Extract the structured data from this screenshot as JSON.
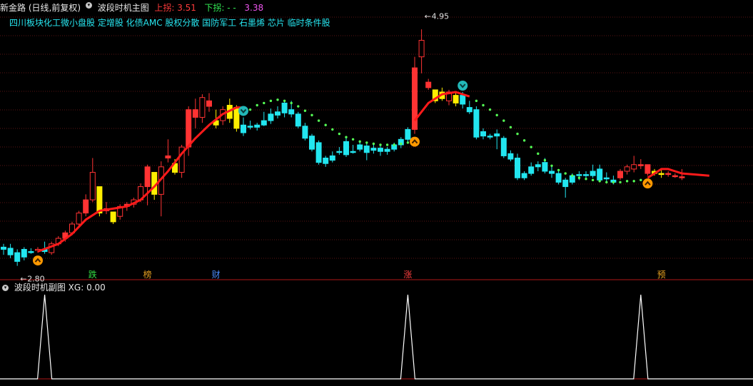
{
  "header": {
    "stock_name": "新金路",
    "period": "(日线,前复权)",
    "main_indicator": "波段时机主图",
    "upper_label": "上拐:",
    "upper_value": "3.51",
    "lower_label": "下拐:",
    "lower_value": "- -",
    "third_value": "3.38"
  },
  "concept_tags": "四川板块化工微小盘股 定增股 化债AMC 股权分散 国防军工 石墨烯 芯片 临时条件股",
  "price_labels": {
    "high": "4.95",
    "low": "2.80"
  },
  "event_markers": [
    {
      "label": "跌",
      "color": "#33dd44"
    },
    {
      "label": "榜",
      "color": "#e6a020"
    },
    {
      "label": "财",
      "color": "#4a8cff"
    },
    {
      "label": "涨",
      "color": "#ff4040"
    },
    {
      "label": "预",
      "color": "#e6a020"
    }
  ],
  "sub_panel": {
    "title": "波段时机副图",
    "xg_label": "XG:",
    "xg_value": "0.00"
  },
  "colors": {
    "up_candle": "#ff3333",
    "down_candle": "#22e6f0",
    "yellow_candle": "#ffee00",
    "trend_line": "#ff1a1a",
    "dots": "#55ff55",
    "grid": "#5a1414",
    "signal_line": "#ffffff",
    "buy_signal": "#ff9900",
    "sell_signal": "#22b8b8"
  },
  "chart_data": {
    "type": "candlestick",
    "candles": [
      {
        "o": 2.95,
        "h": 3.0,
        "l": 2.9,
        "c": 2.97,
        "k": "c"
      },
      {
        "o": 2.96,
        "h": 3.0,
        "l": 2.87,
        "c": 2.9,
        "k": "c"
      },
      {
        "o": 2.92,
        "h": 2.95,
        "l": 2.8,
        "c": 2.84,
        "k": "c"
      },
      {
        "o": 2.88,
        "h": 2.97,
        "l": 2.85,
        "c": 2.95,
        "k": "c"
      },
      {
        "o": 2.93,
        "h": 2.96,
        "l": 2.91,
        "c": 2.93,
        "k": "c"
      },
      {
        "o": 2.94,
        "h": 2.97,
        "l": 2.92,
        "c": 2.95,
        "k": "r"
      },
      {
        "o": 2.95,
        "h": 3.02,
        "l": 2.91,
        "c": 2.93,
        "k": "c"
      },
      {
        "o": 2.92,
        "h": 3.02,
        "l": 2.9,
        "c": 3.0,
        "k": "r"
      },
      {
        "o": 3.0,
        "h": 3.07,
        "l": 2.98,
        "c": 3.05,
        "k": "r"
      },
      {
        "o": 3.05,
        "h": 3.12,
        "l": 3.02,
        "c": 3.1,
        "k": "r"
      },
      {
        "o": 3.1,
        "h": 3.2,
        "l": 3.08,
        "c": 3.18,
        "k": "r"
      },
      {
        "o": 3.18,
        "h": 3.3,
        "l": 3.15,
        "c": 3.28,
        "k": "r"
      },
      {
        "o": 3.28,
        "h": 3.45,
        "l": 3.25,
        "c": 3.4,
        "k": "r"
      },
      {
        "o": 3.4,
        "h": 3.78,
        "l": 3.38,
        "c": 3.65,
        "k": "r"
      },
      {
        "o": 3.52,
        "h": 3.52,
        "l": 3.25,
        "c": 3.28,
        "k": "y"
      },
      {
        "o": 3.3,
        "h": 3.38,
        "l": 3.27,
        "c": 3.32,
        "k": "r"
      },
      {
        "o": 3.29,
        "h": 3.29,
        "l": 3.18,
        "c": 3.2,
        "k": "y"
      },
      {
        "o": 3.25,
        "h": 3.36,
        "l": 3.22,
        "c": 3.34,
        "k": "r"
      },
      {
        "o": 3.34,
        "h": 3.38,
        "l": 3.3,
        "c": 3.36,
        "k": "r"
      },
      {
        "o": 3.36,
        "h": 3.42,
        "l": 3.33,
        "c": 3.4,
        "k": "r"
      },
      {
        "o": 3.4,
        "h": 3.55,
        "l": 3.38,
        "c": 3.52,
        "k": "r"
      },
      {
        "o": 3.52,
        "h": 3.72,
        "l": 3.35,
        "c": 3.7,
        "k": "r"
      },
      {
        "o": 3.65,
        "h": 3.65,
        "l": 3.4,
        "c": 3.45,
        "k": "y"
      },
      {
        "o": 3.45,
        "h": 3.75,
        "l": 3.25,
        "c": 3.7,
        "k": "r"
      },
      {
        "o": 3.8,
        "h": 3.95,
        "l": 3.74,
        "c": 3.78,
        "k": "r"
      },
      {
        "o": 3.73,
        "h": 3.77,
        "l": 3.63,
        "c": 3.65,
        "k": "y"
      },
      {
        "o": 3.65,
        "h": 3.9,
        "l": 3.6,
        "c": 3.88,
        "k": "r"
      },
      {
        "o": 3.88,
        "h": 4.25,
        "l": 3.8,
        "c": 4.22,
        "k": "r"
      },
      {
        "o": 4.22,
        "h": 4.32,
        "l": 4.05,
        "c": 4.15,
        "k": "r"
      },
      {
        "o": 4.15,
        "h": 4.36,
        "l": 4.1,
        "c": 4.33,
        "k": "r"
      },
      {
        "o": 4.3,
        "h": 4.37,
        "l": 4.2,
        "c": 4.25,
        "k": "r"
      },
      {
        "o": 4.12,
        "h": 4.22,
        "l": 4.05,
        "c": 4.08,
        "k": "y"
      },
      {
        "o": 4.12,
        "h": 4.25,
        "l": 4.08,
        "c": 4.22,
        "k": "r"
      },
      {
        "o": 4.26,
        "h": 4.32,
        "l": 4.1,
        "c": 4.14,
        "k": "y"
      },
      {
        "o": 4.24,
        "h": 4.26,
        "l": 4.02,
        "c": 4.05,
        "k": "y"
      },
      {
        "o": 4.08,
        "h": 4.15,
        "l": 3.98,
        "c": 4.01,
        "k": "c"
      },
      {
        "o": 4.07,
        "h": 4.12,
        "l": 4.04,
        "c": 4.06,
        "k": "c"
      },
      {
        "o": 4.06,
        "h": 4.1,
        "l": 4.03,
        "c": 4.08,
        "k": "c"
      },
      {
        "o": 4.12,
        "h": 4.2,
        "l": 4.07,
        "c": 4.08,
        "k": "c"
      },
      {
        "o": 4.12,
        "h": 4.23,
        "l": 4.09,
        "c": 4.18,
        "k": "c"
      },
      {
        "o": 4.2,
        "h": 4.25,
        "l": 4.14,
        "c": 4.17,
        "k": "c"
      },
      {
        "o": 4.19,
        "h": 4.3,
        "l": 4.15,
        "c": 4.28,
        "k": "c"
      },
      {
        "o": 4.22,
        "h": 4.3,
        "l": 4.15,
        "c": 4.18,
        "k": "c"
      },
      {
        "o": 4.18,
        "h": 4.2,
        "l": 4.05,
        "c": 4.07,
        "k": "c"
      },
      {
        "o": 4.07,
        "h": 4.1,
        "l": 3.94,
        "c": 3.96,
        "k": "c"
      },
      {
        "o": 3.98,
        "h": 4.0,
        "l": 3.84,
        "c": 3.86,
        "k": "c"
      },
      {
        "o": 3.92,
        "h": 3.94,
        "l": 3.72,
        "c": 3.74,
        "k": "c"
      },
      {
        "o": 3.78,
        "h": 3.8,
        "l": 3.7,
        "c": 3.73,
        "k": "c"
      },
      {
        "o": 3.76,
        "h": 3.84,
        "l": 3.74,
        "c": 3.8,
        "k": "c"
      },
      {
        "o": 3.84,
        "h": 3.88,
        "l": 3.81,
        "c": 3.84,
        "k": "c"
      },
      {
        "o": 3.93,
        "h": 3.96,
        "l": 3.79,
        "c": 3.81,
        "k": "c"
      },
      {
        "o": 3.84,
        "h": 3.9,
        "l": 3.82,
        "c": 3.84,
        "k": "c"
      },
      {
        "o": 3.9,
        "h": 3.93,
        "l": 3.84,
        "c": 3.86,
        "k": "c"
      },
      {
        "o": 3.89,
        "h": 3.92,
        "l": 3.76,
        "c": 3.83,
        "k": "c"
      },
      {
        "o": 3.85,
        "h": 3.9,
        "l": 3.82,
        "c": 3.87,
        "k": "c"
      },
      {
        "o": 3.87,
        "h": 3.9,
        "l": 3.8,
        "c": 3.84,
        "k": "c"
      },
      {
        "o": 3.84,
        "h": 3.88,
        "l": 3.81,
        "c": 3.86,
        "k": "c"
      },
      {
        "o": 3.86,
        "h": 3.92,
        "l": 3.84,
        "c": 3.9,
        "k": "c"
      },
      {
        "o": 3.9,
        "h": 3.97,
        "l": 3.87,
        "c": 3.95,
        "k": "c"
      },
      {
        "o": 3.95,
        "h": 4.06,
        "l": 3.92,
        "c": 4.04,
        "k": "c"
      },
      {
        "o": 4.04,
        "h": 4.7,
        "l": 4.0,
        "c": 4.6,
        "k": "r"
      },
      {
        "o": 4.7,
        "h": 4.95,
        "l": 4.55,
        "c": 4.85,
        "k": "r"
      },
      {
        "o": 4.47,
        "h": 4.5,
        "l": 4.4,
        "c": 4.42,
        "k": "r"
      },
      {
        "o": 4.4,
        "h": 4.4,
        "l": 4.28,
        "c": 4.3,
        "k": "y"
      },
      {
        "o": 4.38,
        "h": 4.42,
        "l": 4.3,
        "c": 4.32,
        "k": "y"
      },
      {
        "o": 4.3,
        "h": 4.4,
        "l": 4.26,
        "c": 4.38,
        "k": "r"
      },
      {
        "o": 4.35,
        "h": 4.38,
        "l": 4.25,
        "c": 4.28,
        "k": "y"
      },
      {
        "o": 4.35,
        "h": 4.38,
        "l": 4.23,
        "c": 4.27,
        "k": "c"
      },
      {
        "o": 4.24,
        "h": 4.3,
        "l": 4.18,
        "c": 4.2,
        "k": "c"
      },
      {
        "o": 4.22,
        "h": 4.25,
        "l": 3.95,
        "c": 3.97,
        "k": "c"
      },
      {
        "o": 4.02,
        "h": 4.05,
        "l": 3.95,
        "c": 3.98,
        "k": "c"
      },
      {
        "o": 3.98,
        "h": 4.0,
        "l": 3.95,
        "c": 3.97,
        "k": "c"
      },
      {
        "o": 4.0,
        "h": 4.04,
        "l": 3.86,
        "c": 3.98,
        "k": "c"
      },
      {
        "o": 3.96,
        "h": 3.98,
        "l": 3.78,
        "c": 3.8,
        "k": "c"
      },
      {
        "o": 3.82,
        "h": 3.85,
        "l": 3.75,
        "c": 3.77,
        "k": "c"
      },
      {
        "o": 3.78,
        "h": 3.82,
        "l": 3.58,
        "c": 3.6,
        "k": "c"
      },
      {
        "o": 3.64,
        "h": 3.66,
        "l": 3.58,
        "c": 3.6,
        "k": "c"
      },
      {
        "o": 3.64,
        "h": 3.74,
        "l": 3.62,
        "c": 3.7,
        "k": "c"
      },
      {
        "o": 3.72,
        "h": 3.75,
        "l": 3.66,
        "c": 3.7,
        "k": "c"
      },
      {
        "o": 3.74,
        "h": 3.78,
        "l": 3.64,
        "c": 3.66,
        "k": "c"
      },
      {
        "o": 3.66,
        "h": 3.7,
        "l": 3.6,
        "c": 3.64,
        "k": "c"
      },
      {
        "o": 3.64,
        "h": 3.66,
        "l": 3.54,
        "c": 3.56,
        "k": "c"
      },
      {
        "o": 3.58,
        "h": 3.6,
        "l": 3.42,
        "c": 3.52,
        "k": "c"
      },
      {
        "o": 3.56,
        "h": 3.64,
        "l": 3.54,
        "c": 3.62,
        "k": "c"
      },
      {
        "o": 3.62,
        "h": 3.66,
        "l": 3.58,
        "c": 3.63,
        "k": "c"
      },
      {
        "o": 3.62,
        "h": 3.66,
        "l": 3.58,
        "c": 3.63,
        "k": "c"
      },
      {
        "o": 3.66,
        "h": 3.72,
        "l": 3.6,
        "c": 3.62,
        "k": "c"
      },
      {
        "o": 3.68,
        "h": 3.72,
        "l": 3.56,
        "c": 3.58,
        "k": "c"
      },
      {
        "o": 3.6,
        "h": 3.65,
        "l": 3.56,
        "c": 3.6,
        "k": "c"
      },
      {
        "o": 3.58,
        "h": 3.62,
        "l": 3.54,
        "c": 3.56,
        "k": "c"
      },
      {
        "o": 3.6,
        "h": 3.68,
        "l": 3.58,
        "c": 3.66,
        "k": "r"
      },
      {
        "o": 3.66,
        "h": 3.72,
        "l": 3.63,
        "c": 3.7,
        "k": "r"
      },
      {
        "o": 3.68,
        "h": 3.8,
        "l": 3.65,
        "c": 3.72,
        "k": "r"
      },
      {
        "o": 3.72,
        "h": 3.77,
        "l": 3.68,
        "c": 3.71,
        "k": "r"
      },
      {
        "o": 3.72,
        "h": 3.72,
        "l": 3.62,
        "c": 3.64,
        "k": "r"
      },
      {
        "o": 3.66,
        "h": 3.68,
        "l": 3.62,
        "c": 3.64,
        "k": "y"
      },
      {
        "o": 3.64,
        "h": 3.68,
        "l": 3.6,
        "c": 3.63,
        "k": "y"
      },
      {
        "o": 3.64,
        "h": 3.66,
        "l": 3.61,
        "c": 3.63,
        "k": "r"
      },
      {
        "o": 3.62,
        "h": 3.64,
        "l": 3.6,
        "c": 3.62,
        "k": "r"
      },
      {
        "o": 3.61,
        "h": 3.68,
        "l": 3.58,
        "c": 3.61,
        "k": "r"
      }
    ],
    "trend_line": [
      {
        "i": 5,
        "v": 2.93
      },
      {
        "i": 8,
        "v": 3.0
      },
      {
        "i": 10,
        "v": 3.09
      },
      {
        "i": 12,
        "v": 3.22
      },
      {
        "i": 14,
        "v": 3.3
      },
      {
        "i": 16,
        "v": 3.32
      },
      {
        "i": 18,
        "v": 3.34
      },
      {
        "i": 20,
        "v": 3.4
      },
      {
        "i": 22,
        "v": 3.52
      },
      {
        "i": 24,
        "v": 3.66
      },
      {
        "i": 26,
        "v": 3.82
      },
      {
        "i": 28,
        "v": 3.96
      },
      {
        "i": 30,
        "v": 4.08
      },
      {
        "i": 32,
        "v": 4.18
      },
      {
        "i": 34,
        "v": 4.24
      },
      {
        "i": 35,
        "v": 4.24
      },
      {
        "i": 60,
        "v": 4.12
      },
      {
        "i": 61,
        "v": 4.2
      },
      {
        "i": 62,
        "v": 4.28
      },
      {
        "i": 64,
        "v": 4.36
      },
      {
        "i": 66,
        "v": 4.38
      },
      {
        "i": 68,
        "v": 4.34
      },
      {
        "i": 94,
        "v": 3.6
      },
      {
        "i": 95,
        "v": 3.64
      },
      {
        "i": 96,
        "v": 3.68
      },
      {
        "i": 97,
        "v": 3.68
      },
      {
        "i": 98,
        "v": 3.66
      },
      {
        "i": 99,
        "v": 3.64
      },
      {
        "i": 101,
        "v": 3.63
      },
      {
        "i": 103,
        "v": 3.62
      }
    ],
    "trend_segments": [
      [
        0,
        15
      ],
      [
        16,
        21
      ],
      [
        22,
        29
      ]
    ],
    "dots": [
      {
        "i": 36,
        "v": 4.22
      },
      {
        "i": 37,
        "v": 4.26
      },
      {
        "i": 38,
        "v": 4.28
      },
      {
        "i": 39,
        "v": 4.3
      },
      {
        "i": 40,
        "v": 4.31
      },
      {
        "i": 41,
        "v": 4.3
      },
      {
        "i": 42,
        "v": 4.28
      },
      {
        "i": 43,
        "v": 4.25
      },
      {
        "i": 44,
        "v": 4.21
      },
      {
        "i": 45,
        "v": 4.17
      },
      {
        "i": 46,
        "v": 4.12
      },
      {
        "i": 47,
        "v": 4.08
      },
      {
        "i": 48,
        "v": 4.04
      },
      {
        "i": 49,
        "v": 4.0
      },
      {
        "i": 50,
        "v": 3.97
      },
      {
        "i": 51,
        "v": 3.95
      },
      {
        "i": 52,
        "v": 3.93
      },
      {
        "i": 53,
        "v": 3.92
      },
      {
        "i": 54,
        "v": 3.91
      },
      {
        "i": 55,
        "v": 3.9
      },
      {
        "i": 56,
        "v": 3.9
      },
      {
        "i": 57,
        "v": 3.9
      },
      {
        "i": 58,
        "v": 3.91
      },
      {
        "i": 59,
        "v": 3.92
      },
      {
        "i": 69,
        "v": 4.3
      },
      {
        "i": 70,
        "v": 4.26
      },
      {
        "i": 71,
        "v": 4.22
      },
      {
        "i": 72,
        "v": 4.17
      },
      {
        "i": 73,
        "v": 4.12
      },
      {
        "i": 74,
        "v": 4.06
      },
      {
        "i": 75,
        "v": 4.0
      },
      {
        "i": 76,
        "v": 3.94
      },
      {
        "i": 77,
        "v": 3.88
      },
      {
        "i": 78,
        "v": 3.82
      },
      {
        "i": 79,
        "v": 3.76
      },
      {
        "i": 80,
        "v": 3.71
      },
      {
        "i": 81,
        "v": 3.67
      },
      {
        "i": 82,
        "v": 3.64
      },
      {
        "i": 83,
        "v": 3.62
      },
      {
        "i": 84,
        "v": 3.6
      },
      {
        "i": 85,
        "v": 3.59
      },
      {
        "i": 86,
        "v": 3.58
      },
      {
        "i": 87,
        "v": 3.57
      },
      {
        "i": 88,
        "v": 3.56
      },
      {
        "i": 89,
        "v": 3.56
      },
      {
        "i": 90,
        "v": 3.56
      },
      {
        "i": 91,
        "v": 3.57
      },
      {
        "i": 92,
        "v": 3.57
      },
      {
        "i": 93,
        "v": 3.58
      }
    ],
    "buy_signals": [
      {
        "i": 5
      },
      {
        "i": 60
      },
      {
        "i": 94
      }
    ],
    "sell_signals": [
      {
        "i": 35
      },
      {
        "i": 67
      }
    ],
    "event_candles": [
      13,
      21,
      31,
      59,
      96
    ],
    "sub_spikes": [
      6,
      59,
      93
    ],
    "price_range": [
      2.7,
      5.1
    ]
  }
}
